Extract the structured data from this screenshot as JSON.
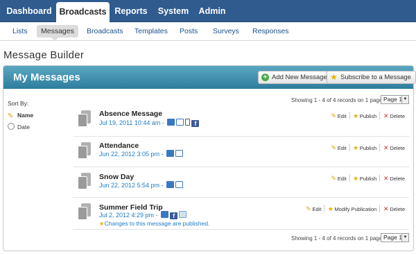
{
  "topnav": {
    "items": [
      {
        "label": "Dashboard"
      },
      {
        "label": "Broadcasts"
      },
      {
        "label": "Reports"
      },
      {
        "label": "System"
      },
      {
        "label": "Admin"
      }
    ],
    "active": "Broadcasts"
  },
  "subnav": {
    "items": [
      {
        "label": "Lists"
      },
      {
        "label": "Messages"
      },
      {
        "label": "Broadcasts"
      },
      {
        "label": "Templates"
      },
      {
        "label": "Posts"
      },
      {
        "label": "Surveys"
      },
      {
        "label": "Responses"
      }
    ],
    "active": "Messages"
  },
  "page": {
    "title": "Message Builder"
  },
  "panel": {
    "title": "My Messages",
    "add_button": "Add New Message",
    "subscribe_button": "Subscribe to a Message"
  },
  "sort": {
    "label": "Sort By:",
    "options": [
      {
        "label": "Name",
        "icon": "pencil-icon",
        "selected": true
      },
      {
        "label": "Date",
        "icon": "clock-icon",
        "selected": false
      }
    ]
  },
  "paging": {
    "text": "Showing 1 - 4 of 4 records on 1 pages",
    "page_select": "Page 1"
  },
  "messages": [
    {
      "title": "Absence Message",
      "date": "Jul 19, 2011 10:44 am -",
      "channels": [
        "phone-icon",
        "email-icon",
        "sms-icon",
        "facebook-icon"
      ],
      "actions": {
        "edit": "Edit",
        "publish": "Publish",
        "delete": "Delete"
      }
    },
    {
      "title": "Attendance",
      "date": "Jun 22, 2012 3:05 pm -",
      "channels": [
        "phone-icon",
        "email-icon"
      ],
      "actions": {
        "edit": "Edit",
        "publish": "Publish",
        "delete": "Delete"
      }
    },
    {
      "title": "Snow Day",
      "date": "Jun 22, 2012 5:54 pm -",
      "channels": [
        "phone-icon",
        "email-icon"
      ],
      "actions": {
        "edit": "Edit",
        "publish": "Publish",
        "delete": "Delete"
      }
    },
    {
      "title": "Summer Field Trip",
      "date": "Jul 2, 2012 4:29 pm -",
      "channels": [
        "phone-icon",
        "facebook-icon",
        "web-icon"
      ],
      "note": "Changes to this message are published.",
      "actions": {
        "edit": "Edit",
        "publish": "Modify Publication",
        "delete": "Delete"
      }
    }
  ],
  "colors": {
    "nav_bg": "#2f5b8f",
    "panel_header": "#3c8fb0",
    "link": "#1b7bc4",
    "delete": "#d62b2b"
  }
}
